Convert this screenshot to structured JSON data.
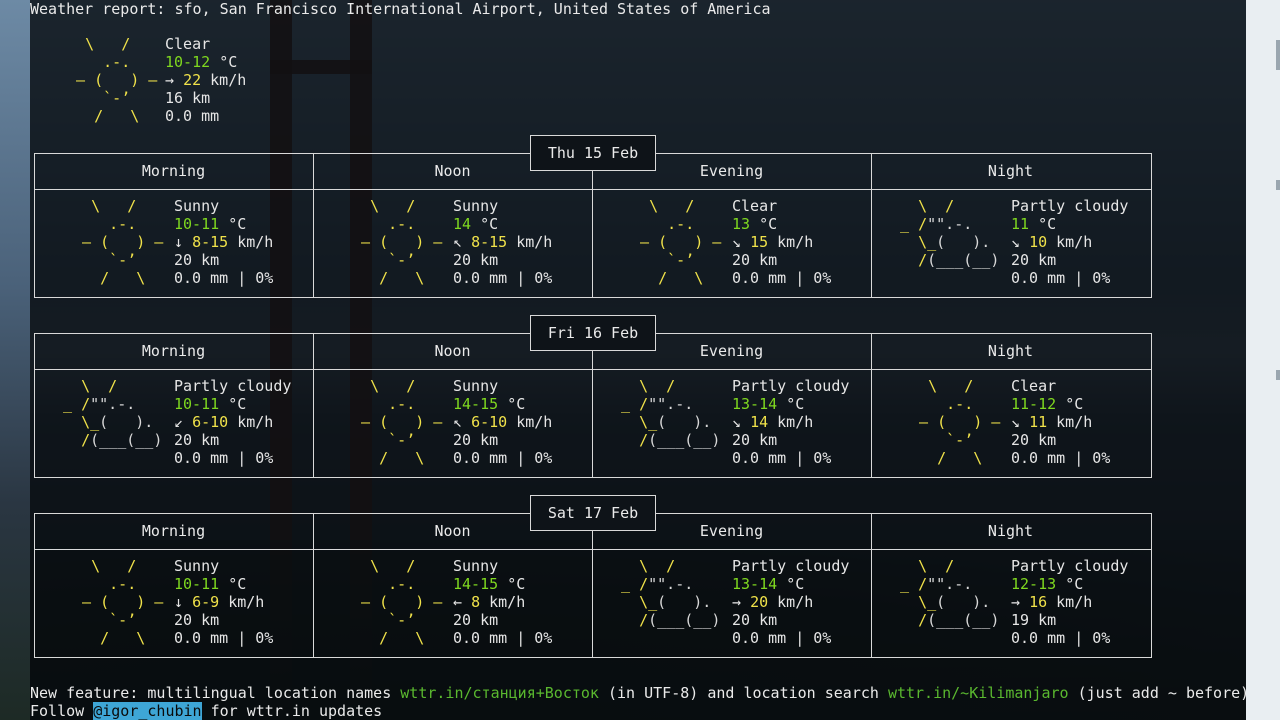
{
  "header": "Weather report: sfo, San Francisco International Airport, United States of America",
  "current": {
    "condition": "Clear",
    "temp": "10-12",
    "temp_unit": "°C",
    "wind_dir": "→",
    "wind_speed": "22",
    "wind_unit": "km/h",
    "visibility": "16 km",
    "precip": "0.0 mm"
  },
  "days": [
    {
      "date": "Thu 15 Feb",
      "periods": [
        {
          "name": "Morning",
          "condition": "Sunny",
          "temp": "10-11",
          "wind_dir": "↓",
          "wind": "8-15",
          "visibility": "20 km",
          "precip": "0.0 mm | 0%",
          "icon": "sun-icon"
        },
        {
          "name": "Noon",
          "condition": "Sunny",
          "temp": "14",
          "wind_dir": "↖",
          "wind": "8-15",
          "visibility": "20 km",
          "precip": "0.0 mm | 0%",
          "icon": "sun-icon"
        },
        {
          "name": "Evening",
          "condition": "Clear",
          "temp": "13",
          "wind_dir": "↘",
          "wind": "15",
          "visibility": "20 km",
          "precip": "0.0 mm | 0%",
          "icon": "sun-icon"
        },
        {
          "name": "Night",
          "condition": "Partly cloudy",
          "temp": "11",
          "wind_dir": "↘",
          "wind": "10",
          "visibility": "20 km",
          "precip": "0.0 mm | 0%",
          "icon": "partly-cloudy-icon"
        }
      ]
    },
    {
      "date": "Fri 16 Feb",
      "periods": [
        {
          "name": "Morning",
          "condition": "Partly cloudy",
          "temp": "10-11",
          "wind_dir": "↙",
          "wind": "6-10",
          "visibility": "20 km",
          "precip": "0.0 mm | 0%",
          "icon": "partly-cloudy-icon"
        },
        {
          "name": "Noon",
          "condition": "Sunny",
          "temp": "14-15",
          "wind_dir": "↖",
          "wind": "6-10",
          "visibility": "20 km",
          "precip": "0.0 mm | 0%",
          "icon": "sun-icon"
        },
        {
          "name": "Evening",
          "condition": "Partly cloudy",
          "temp": "13-14",
          "wind_dir": "↘",
          "wind": "14",
          "visibility": "20 km",
          "precip": "0.0 mm | 0%",
          "icon": "partly-cloudy-icon"
        },
        {
          "name": "Night",
          "condition": "Clear",
          "temp": "11-12",
          "wind_dir": "↘",
          "wind": "11",
          "visibility": "20 km",
          "precip": "0.0 mm | 0%",
          "icon": "sun-icon"
        }
      ]
    },
    {
      "date": "Sat 17 Feb",
      "periods": [
        {
          "name": "Morning",
          "condition": "Sunny",
          "temp": "10-11",
          "wind_dir": "↓",
          "wind": "6-9",
          "visibility": "20 km",
          "precip": "0.0 mm | 0%",
          "icon": "sun-icon"
        },
        {
          "name": "Noon",
          "condition": "Sunny",
          "temp": "14-15",
          "wind_dir": "←",
          "wind": "8",
          "visibility": "20 km",
          "precip": "0.0 mm | 0%",
          "icon": "sun-icon"
        },
        {
          "name": "Evening",
          "condition": "Partly cloudy",
          "temp": "13-14",
          "wind_dir": "→",
          "wind": "20",
          "visibility": "20 km",
          "precip": "0.0 mm | 0%",
          "icon": "partly-cloudy-icon"
        },
        {
          "name": "Night",
          "condition": "Partly cloudy",
          "temp": "12-13",
          "wind_dir": "→",
          "wind": "16",
          "visibility": "19 km",
          "precip": "0.0 mm | 0%",
          "icon": "partly-cloudy-icon"
        }
      ]
    }
  ],
  "units": {
    "temp": "°C",
    "wind": "km/h"
  },
  "footer": {
    "line1_prefix": "New feature: multilingual location names ",
    "link1": "wttr.in/станция+Восток",
    "line1_mid": " (in UTF-8) and location search ",
    "link2": "wttr.in/~Kilimanjaro",
    "line1_suffix": " (just add ~ before)",
    "line2_prefix": "Follow ",
    "handle": "@igor_chubin",
    "line2_suffix": " for wttr.in updates"
  }
}
